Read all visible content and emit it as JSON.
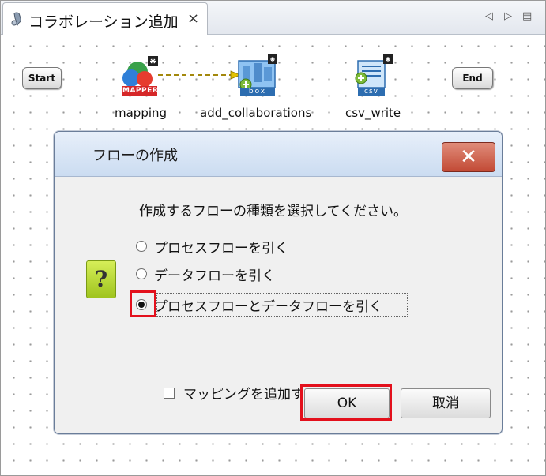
{
  "tab": {
    "title": "コラボレーション追加",
    "close": "×"
  },
  "view_controls": {
    "left": "◁",
    "right": "▷",
    "menu": "▤"
  },
  "canvas": {
    "start_label": "Start",
    "end_label": "End",
    "nodes": [
      {
        "label": "mapping",
        "badge": "MAPPER"
      },
      {
        "label": "add_collaborations",
        "badge": "box"
      },
      {
        "label": "csv_write",
        "badge": "csv"
      }
    ]
  },
  "dialog": {
    "title": "フローの作成",
    "close": "✕",
    "message": "作成するフローの種類を選択してください。",
    "options": [
      {
        "label": "プロセスフローを引く",
        "selected": false
      },
      {
        "label": "データフローを引く",
        "selected": false
      },
      {
        "label": "プロセスフローとデータフローを引く",
        "selected": true
      }
    ],
    "checkbox_label": "マッピングを追加する",
    "question_mark": "?",
    "ok_label": "OK",
    "cancel_label": "取消"
  },
  "colors": {
    "highlight": "#e3101c",
    "title_bar": "#cbdcf1",
    "close_button": "#c24a35",
    "question_icon": "#b4d430"
  }
}
